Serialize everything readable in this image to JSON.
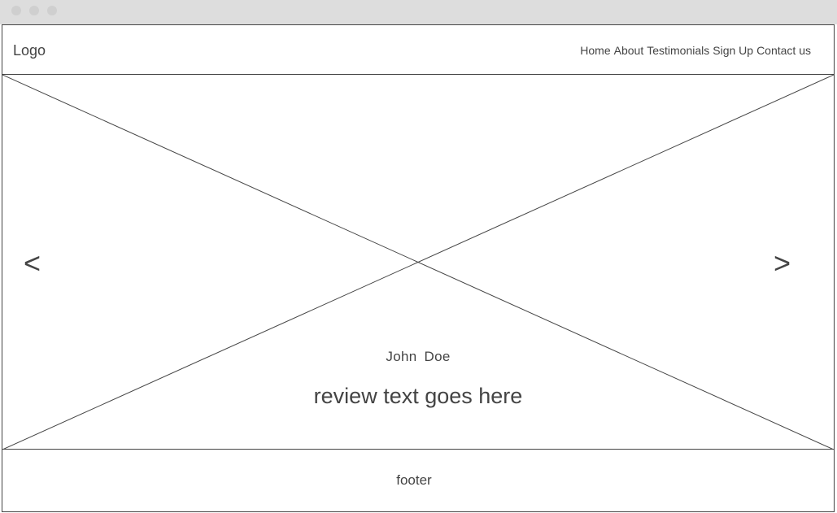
{
  "header": {
    "logo": "Logo",
    "nav": [
      {
        "label": "Home"
      },
      {
        "label": "About"
      },
      {
        "label": "Testimonials"
      },
      {
        "label": "Sign Up"
      },
      {
        "label": "Contact us"
      }
    ]
  },
  "carousel": {
    "prev_label": "<",
    "next_label": ">",
    "reviewer_name": "John  Doe",
    "review_text": "review text goes here"
  },
  "footer": {
    "text": "footer"
  },
  "colors": {
    "titlebar": "#dddddd",
    "line": "#444444",
    "text": "#444444",
    "background": "#ffffff"
  }
}
